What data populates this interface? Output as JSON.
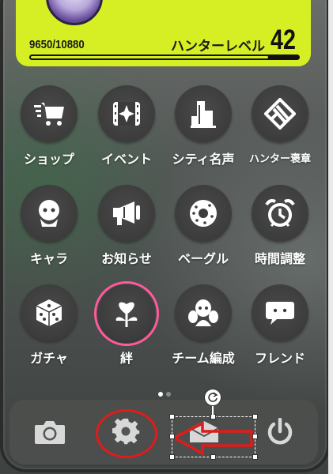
{
  "profile": {
    "exp_text": "9650/10880",
    "exp_fraction": 0.887,
    "level_label": "ハンターレベル",
    "level_value": "42"
  },
  "apps": [
    {
      "label": "ショップ",
      "icon": "cart-icon"
    },
    {
      "label": "イベント",
      "icon": "film-sparkle-icon"
    },
    {
      "label": "シティ名声",
      "icon": "city-building-icon"
    },
    {
      "label": "ハンター褒章",
      "icon": "medal-badge-icon"
    },
    {
      "label": "キャラ",
      "icon": "character-icon"
    },
    {
      "label": "お知らせ",
      "icon": "megaphone-icon"
    },
    {
      "label": "ベーグル",
      "icon": "bagel-icon"
    },
    {
      "label": "時間調整",
      "icon": "alarm-clock-icon"
    },
    {
      "label": "ガチャ",
      "icon": "dice-icon"
    },
    {
      "label": "絆",
      "icon": "heart-flower-icon"
    },
    {
      "label": "チーム編成",
      "icon": "team-icon"
    },
    {
      "label": "フレンド",
      "icon": "chat-bubble-icon"
    }
  ],
  "dock": [
    {
      "icon": "camera-icon"
    },
    {
      "icon": "settings-gear-icon"
    },
    {
      "icon": "mail-icon"
    },
    {
      "icon": "power-icon"
    }
  ],
  "page_indicator": {
    "count": 2,
    "active": 0
  },
  "colors": {
    "accent": "#d6ef24",
    "highlight_ring": "#ff5a9a",
    "annotation_red": "#e01b1b"
  }
}
